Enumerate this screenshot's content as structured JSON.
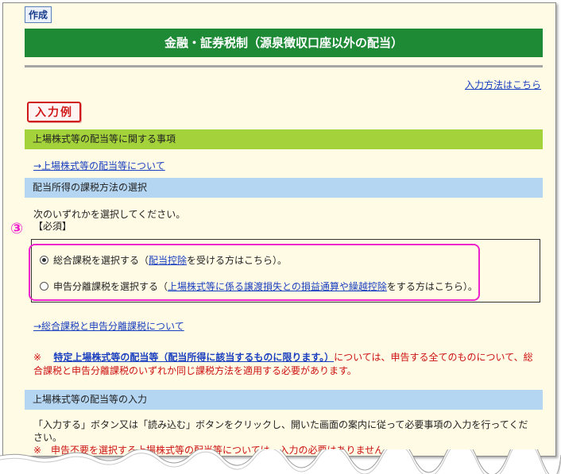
{
  "tab_label": "作成",
  "header_title": "金融・証券税制（源泉徴収口座以外の配当）",
  "help_link": "入力方法はこちら",
  "example_badge": "入力例",
  "section1": {
    "title": "上場株式等の配当等に関する事項",
    "link": "→上場株式等の配当等について"
  },
  "section2": {
    "title": "配当所得の課税方法の選択",
    "instruction": "次のいずれかを選択してください。",
    "required": "【必須】",
    "step_number": "③",
    "options": [
      {
        "prefix": "総合課税を選択する（",
        "link": "配当控除",
        "suffix": "を受ける方はこちら）。",
        "checked": true
      },
      {
        "prefix": "申告分離課税を選択する（",
        "link": "上場株式等に係る譲渡損失との損益通算や繰越控除",
        "suffix": "をする方はこちら）。",
        "checked": false
      }
    ],
    "link": "→総合課税と申告分離課税について",
    "note_mark": "※",
    "note_link": "特定上場株式等の配当等（配当所得に該当するものに限ります。）",
    "note_text": "については、申告する全てのものについて、総合課税と申告分離課税のいずれか同じ課税方法を適用する必要があります。"
  },
  "section3": {
    "title": "上場株式等の配当等の入力",
    "description": "「入力する」ボタン又は「読み込む」ボタンをクリックし、開いた画面の案内に従って必要事項の入力を行ってください。",
    "note": "※　申告不要を選択する上場株式等の配当等については、入力の必要はありません。"
  },
  "colors": {
    "header_green": "#1e8a36",
    "section_lime": "#a3d23a",
    "section_blue": "#b5d6f2",
    "highlight_magenta": "#ee22cc",
    "note_red": "#cc1111",
    "link_blue": "#1a3fbf"
  }
}
